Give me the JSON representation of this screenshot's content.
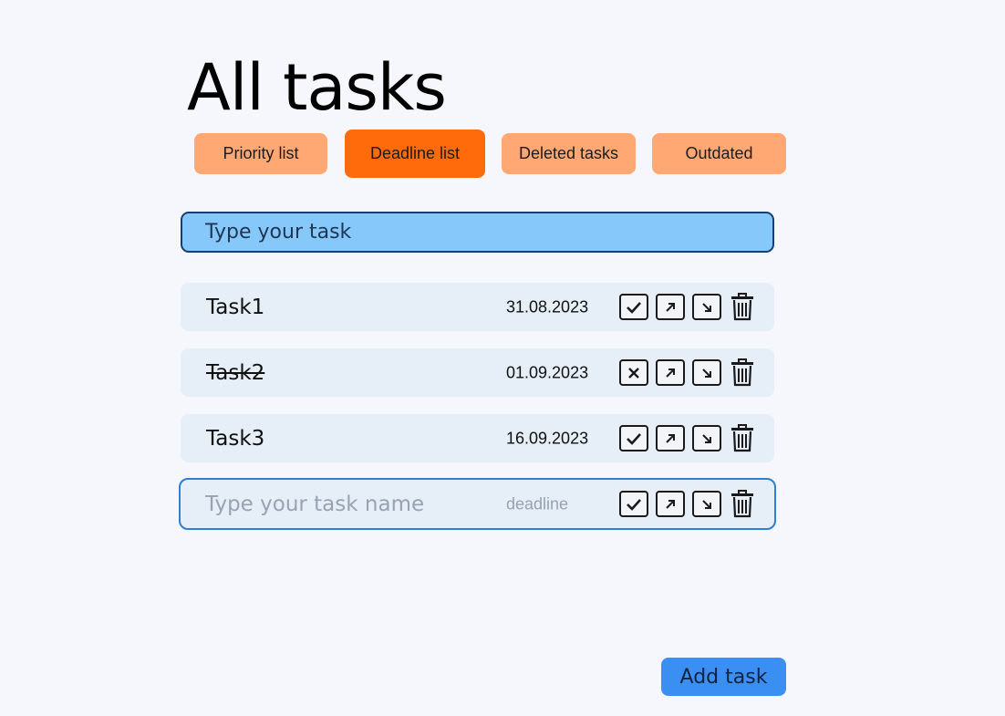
{
  "page": {
    "title": "All tasks"
  },
  "tabs": [
    {
      "label": "Priority list",
      "active": false
    },
    {
      "label": "Deadline list",
      "active": true
    },
    {
      "label": "Deleted tasks",
      "active": false
    },
    {
      "label": "Outdated",
      "active": false
    }
  ],
  "new_task": {
    "placeholder": "Type your task"
  },
  "tasks": [
    {
      "name": "Task1",
      "date": "31.08.2023",
      "status": "done-check",
      "strikethrough": false
    },
    {
      "name": "Task2",
      "date": "01.09.2023",
      "status": "cancel-x",
      "strikethrough": true
    },
    {
      "name": "Task3",
      "date": "16.09.2023",
      "status": "done-check",
      "strikethrough": false
    }
  ],
  "editing_task": {
    "name_placeholder": "Type your task name",
    "date_placeholder": "deadline"
  },
  "icons": {
    "check": "check-icon",
    "cross": "x-icon",
    "up": "arrow-up-right-icon",
    "down": "arrow-down-right-icon",
    "delete": "trash-icon"
  },
  "add_button": {
    "label": "Add task"
  },
  "colors": {
    "background": "#f5f7fc",
    "tab": "#ffa874",
    "tab_active": "#ff6b0a",
    "input_bg": "#87c8fb",
    "input_border": "#173f75",
    "row_bg": "#e6eef7",
    "edit_border": "#2f7fd3",
    "add_button": "#3b8ff2"
  }
}
